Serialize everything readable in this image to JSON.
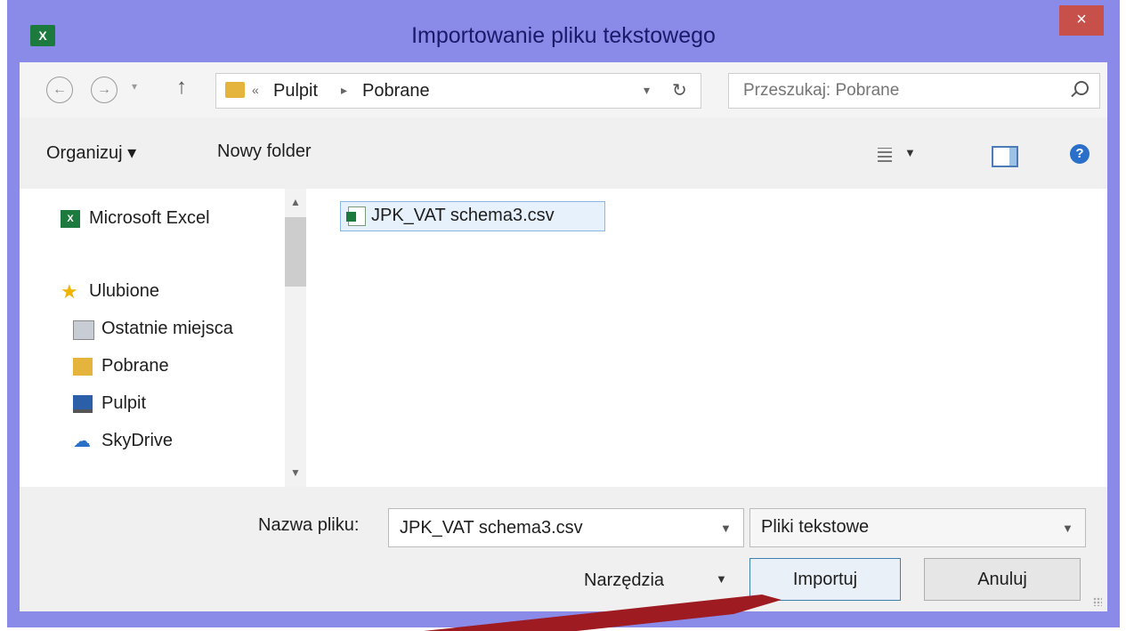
{
  "window": {
    "title": "Importowanie pliku tekstowego",
    "app_icon": "excel-icon",
    "close_label": "×"
  },
  "navigation": {
    "breadcrumb_prefix": "«",
    "breadcrumb": [
      "Pulpit",
      "Pobrane"
    ],
    "search_placeholder": "Przeszukaj: Pobrane"
  },
  "toolbar": {
    "organize_label": "Organizuj ▾",
    "new_folder_label": "Nowy folder"
  },
  "sidebar": {
    "items": [
      {
        "label": "Microsoft Excel",
        "icon": "excel-icon"
      },
      {
        "label": "Ulubione",
        "icon": "star-icon"
      },
      {
        "label": "Ostatnie miejsca",
        "icon": "recent-places-icon"
      },
      {
        "label": "Pobrane",
        "icon": "downloads-folder-icon"
      },
      {
        "label": "Pulpit",
        "icon": "desktop-icon"
      },
      {
        "label": "SkyDrive",
        "icon": "skydrive-cloud-icon"
      }
    ]
  },
  "files": [
    {
      "name": "JPK_VAT schema3.csv",
      "icon": "csv-file-icon",
      "selected": true
    }
  ],
  "footer": {
    "filename_label": "Nazwa pliku:",
    "filename_value": "JPK_VAT schema3.csv",
    "filetype_value": "Pliki tekstowe",
    "tools_label": "Narzędzia",
    "import_label": "Importuj",
    "cancel_label": "Anuluj"
  },
  "colors": {
    "frame": "#8a8be8",
    "close_button": "#c7504a",
    "annotation_arrow": "#9e1b22",
    "selection": "#e6f1fb"
  }
}
